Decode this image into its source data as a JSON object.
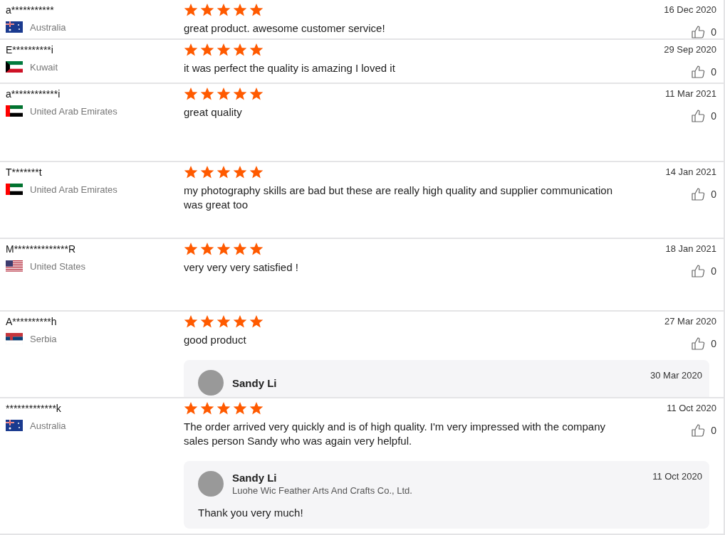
{
  "reviews": [
    {
      "reviewer": "a***********",
      "country": "Australia",
      "stars": 5,
      "text": "great product. awesome customer service!",
      "date": "16 Dec 2020",
      "likes": "0"
    },
    {
      "reviewer": "E**********i",
      "country": "Kuwait",
      "stars": 5,
      "text": "it was perfect the quality is amazing I loved it",
      "date": "29 Sep 2020",
      "likes": "0"
    },
    {
      "reviewer": "a************i",
      "country": "United Arab Emirates",
      "stars": 5,
      "text": "great quality",
      "date": "11 Mar 2021",
      "likes": "0"
    },
    {
      "reviewer": "T*******t",
      "country": "United Arab Emirates",
      "stars": 5,
      "text": "my photography skills are bad but these are really high quality and supplier communication was great too",
      "date": "14 Jan 2021",
      "likes": "0"
    },
    {
      "reviewer": "M**************R",
      "country": "United States",
      "stars": 5,
      "text": "very very very satisfied !",
      "date": "18 Jan 2021",
      "likes": "0"
    },
    {
      "reviewer": "A**********h",
      "country": "Serbia",
      "stars": 5,
      "text": "good product",
      "date": "27 Mar 2020",
      "likes": "0",
      "reply": {
        "name": "Sandy Li",
        "date": "30 Mar 2020"
      }
    },
    {
      "reviewer": "*************k",
      "country": "Australia",
      "stars": 5,
      "text": "The order arrived very quickly and is of high quality. I'm very impressed with the company sales person Sandy who was again very helpful.",
      "date": "11 Oct 2020",
      "likes": "0",
      "reply": {
        "name": "Sandy Li",
        "company": "Luohe Wic Feather Arts And Crafts Co., Ltd.",
        "date": "11 Oct 2020",
        "text": "Thank you very much!"
      }
    }
  ]
}
